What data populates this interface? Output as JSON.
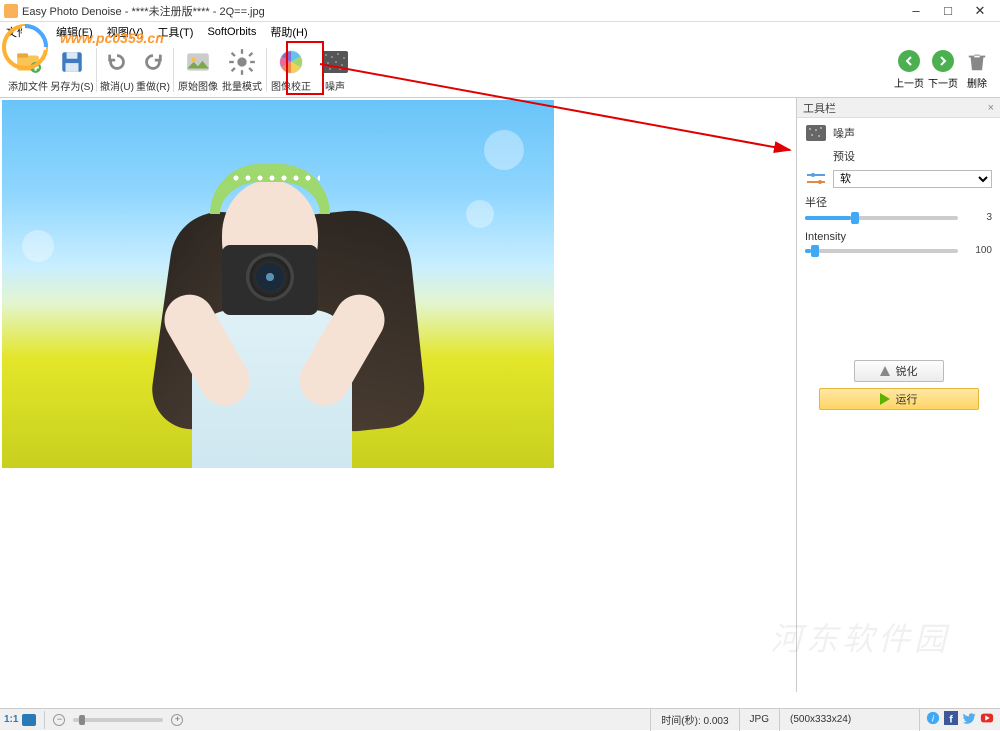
{
  "window": {
    "title": "Easy Photo Denoise - ****未注册版**** - 2Q==.jpg",
    "minimize": "–",
    "maximize": "□",
    "close": "✕"
  },
  "menu": {
    "file": "文件(F)",
    "edit": "编辑(E)",
    "view": "视图(V)",
    "tools": "工具(T)",
    "sorbits": "SoftOrbits",
    "help": "帮助(H)"
  },
  "toolbar": {
    "add_file": "添加文件",
    "save_as": "另存为(S)",
    "undo": "撤消(U)",
    "redo": "重做(R)",
    "original": "原始图像",
    "batch": "批量模式",
    "correction": "图像校正",
    "noise": "噪声",
    "prev": "上一页",
    "next": "下一页",
    "delete": "删除"
  },
  "panel": {
    "title": "工具栏",
    "noise_label": "噪声",
    "preset_label": "预设",
    "preset_value": "软",
    "radius_label": "半径",
    "radius_value": "3",
    "intensity_label": "Intensity",
    "intensity_value": "100",
    "sharpen_btn": "锐化",
    "run_btn": "运行"
  },
  "statusbar": {
    "zoom_label": "1:1",
    "time_label": "时间(秒): 0.003",
    "format": "JPG",
    "dimensions": "(500x333x24)"
  },
  "watermark": {
    "url": "www.pc0359.cn",
    "name": "河东软件园"
  },
  "chart_data": null
}
